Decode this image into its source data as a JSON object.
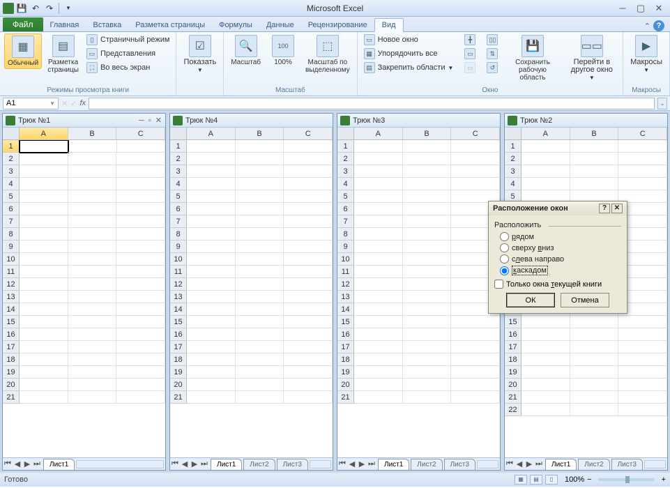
{
  "app": {
    "title": "Microsoft Excel"
  },
  "tabs": {
    "file": "Файл",
    "items": [
      "Главная",
      "Вставка",
      "Разметка страницы",
      "Формулы",
      "Данные",
      "Рецензирование",
      "Вид"
    ],
    "active": "Вид"
  },
  "ribbon": {
    "views": {
      "normal": "Обычный",
      "pagelayout": "Разметка\nстраницы",
      "pagebreak": "Страничный режим",
      "customviews": "Представления",
      "fullscreen": "Во весь экран",
      "label": "Режимы просмотра книги"
    },
    "show": {
      "btn": "Показать",
      "label": ""
    },
    "zoom": {
      "zoom": "Масштаб",
      "hundred": "100%",
      "selection": "Масштаб по\nвыделенному",
      "label": "Масштаб"
    },
    "window": {
      "newwin": "Новое окно",
      "arrange": "Упорядочить все",
      "freeze": "Закрепить области",
      "save": "Сохранить\nрабочую область",
      "switch": "Перейти в\nдругое окно",
      "label": "Окно"
    },
    "macros": {
      "btn": "Макросы",
      "label": "Макросы"
    }
  },
  "namebox": "A1",
  "panes": [
    {
      "title": "Трюк №1",
      "active": true,
      "cols": [
        "A",
        "B",
        "C"
      ],
      "sheets": [
        "Лист1"
      ],
      "selcell": true
    },
    {
      "title": "Трюк №4",
      "active": false,
      "cols": [
        "A",
        "B",
        "C"
      ],
      "sheets": [
        "Лист1",
        "Лист2",
        "Лист3"
      ],
      "selcell": false
    },
    {
      "title": "Трюк №3",
      "active": false,
      "cols": [
        "A",
        "B",
        "C"
      ],
      "sheets": [
        "Лист1",
        "Лист2",
        "Лист3"
      ],
      "selcell": false
    },
    {
      "title": "Трюк №2",
      "active": false,
      "cols": [
        "A",
        "B",
        "C"
      ],
      "sheets": [
        "Лист1",
        "Лист2",
        "Лист3"
      ],
      "selcell": false
    }
  ],
  "rows": 21,
  "status": {
    "ready": "Готово",
    "zoom": "100%"
  },
  "dialog": {
    "title": "Расположение окон",
    "group": "Расположить",
    "opts": {
      "tiled_u": "р",
      "tiled": "ядом",
      "horiz": "сверху ",
      "horiz_u": "в",
      "horiz2": "низ",
      "vert": "с",
      "vert_u": "л",
      "vert2": "ева направо",
      "casc_u": "к",
      "casc": "аскадом"
    },
    "chk_pre": "Только окна ",
    "chk_u": "т",
    "chk_post": "екущей книги",
    "ok": "ОК",
    "cancel": "Отмена"
  }
}
